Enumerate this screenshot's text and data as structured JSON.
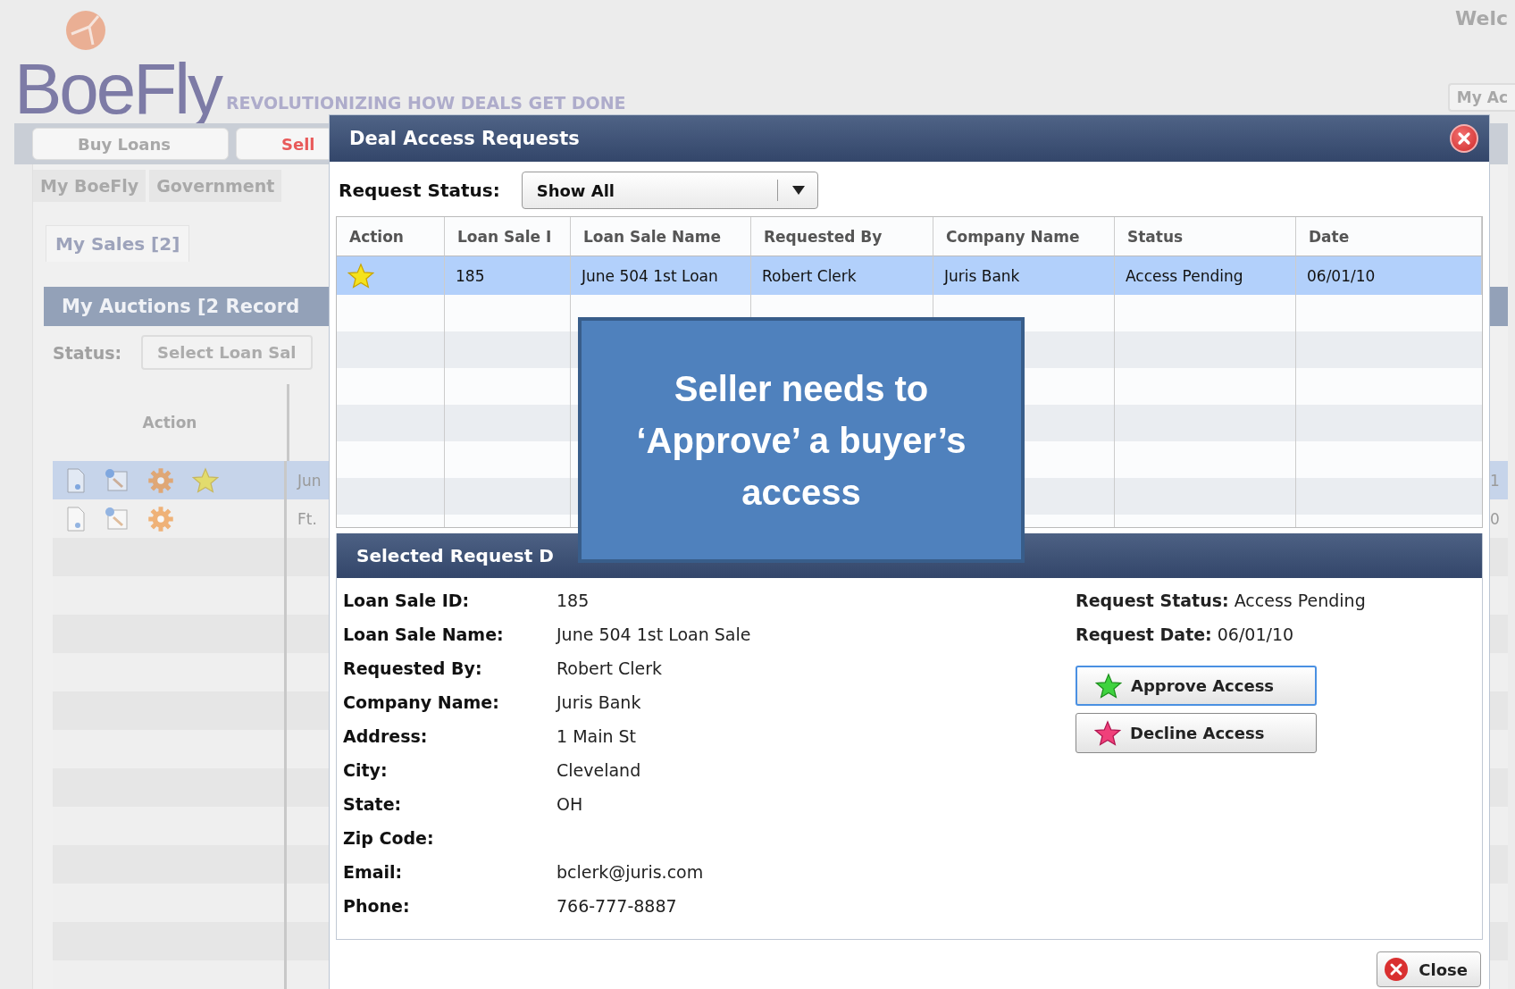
{
  "page": {
    "logo": "BoeFly",
    "tagline": "REVOLUTIONIZING HOW DEALS GET DONE",
    "welcome": "Welc",
    "account_button": "My Ac",
    "nav_tabs": [
      {
        "label": "Buy Loans",
        "selected": false
      },
      {
        "label": "Sell",
        "selected": true
      }
    ],
    "sub_tabs": [
      "My BoeFly",
      "Government"
    ],
    "section_tab": "My Sales [2]",
    "panel_title": "My Auctions [2 Record",
    "status_label": "Status:",
    "status_select": "Select Loan Sal",
    "table": {
      "columns": [
        "Action"
      ],
      "rows": [
        {
          "selected": true,
          "starred": true,
          "cells": [
            "",
            "Jun",
            "1"
          ]
        },
        {
          "selected": false,
          "starred": false,
          "cells": [
            "",
            "Ft.",
            "0"
          ]
        }
      ]
    }
  },
  "dialog": {
    "title": "Deal Access Requests",
    "filter_label": "Request Status:",
    "filter_value": "Show All",
    "columns": [
      "Action",
      "Loan Sale I",
      "Loan Sale Name",
      "Requested By",
      "Company Name",
      "Status",
      "Date"
    ],
    "rows": [
      {
        "selected": true,
        "starred": true,
        "cells": [
          "",
          "185",
          "June 504 1st Loan",
          "Robert Clerk",
          "Juris Bank",
          "Access Pending",
          "06/01/10"
        ]
      }
    ],
    "details": {
      "title": "Selected Request D",
      "fields": [
        {
          "label": "Loan Sale ID:",
          "value": "185"
        },
        {
          "label": "Loan Sale Name:",
          "value": "June 504 1st Loan Sale"
        },
        {
          "label": "Requested By:",
          "value": "Robert Clerk"
        },
        {
          "label": "Company Name:",
          "value": "Juris Bank"
        },
        {
          "label": "Address:",
          "value": "1 Main St"
        },
        {
          "label": "City:",
          "value": "Cleveland"
        },
        {
          "label": "State:",
          "value": "OH"
        },
        {
          "label": "Zip Code:"
        },
        {
          "label": "Email:",
          "value": "bclerk@juris.com"
        },
        {
          "label": "Phone:",
          "value": "766-777-8887"
        }
      ],
      "status_fields": [
        {
          "label": "Request Status:",
          "value": "Access Pending"
        },
        {
          "label": "Request Date:",
          "value": "06/01/10"
        }
      ],
      "buttons": [
        {
          "label": "Approve Access",
          "kind": "approve"
        },
        {
          "label": "Decline Access",
          "kind": "decline"
        }
      ]
    },
    "close_button": "Close"
  },
  "callout": {
    "text": "Seller needs to ‘Approve’ a buyer’s access"
  }
}
